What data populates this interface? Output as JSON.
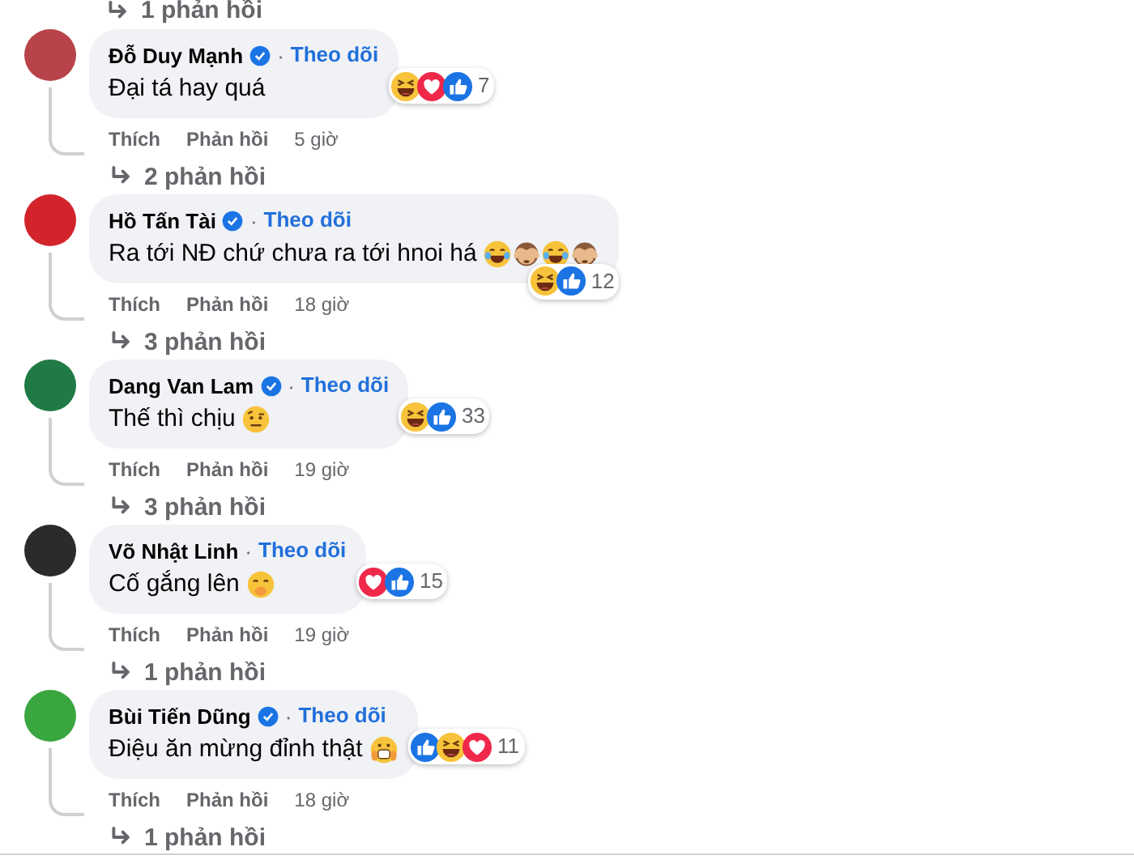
{
  "top_replies": "1 phản hồi",
  "comments": [
    {
      "author": "Đỗ Duy Mạnh",
      "verified": true,
      "separator": "·",
      "follow": "Theo dõi",
      "color": "#b8434a",
      "text": "Đại tá hay quá",
      "reactions": [
        {
          "kind": "haha"
        },
        {
          "kind": "love"
        },
        {
          "kind": "like"
        }
      ],
      "reaction_count": "7",
      "actions": [
        "Thích",
        "Phản hồi"
      ],
      "time": "5 giờ",
      "replies": "2 phản hồi"
    },
    {
      "author": "Hồ Tấn Tài",
      "verified": true,
      "separator": "·",
      "follow": "Theo dõi",
      "color": "#d3242c",
      "text": "Ra tới NĐ chứ chưa ra tới hnoi há",
      "emoji": [
        {
          "kind": "tears-of-joy"
        },
        {
          "kind": "monkey"
        },
        {
          "kind": "tears-of-joy"
        },
        {
          "kind": "monkey"
        }
      ],
      "reactions": [
        {
          "kind": "haha"
        },
        {
          "kind": "like"
        }
      ],
      "reaction_count": "12",
      "actions": [
        "Thích",
        "Phản hồi"
      ],
      "time": "18 giờ",
      "replies": "3 phản hồi"
    },
    {
      "author": "Dang Van Lam",
      "verified": true,
      "separator": "·",
      "follow": "Theo dõi",
      "color": "#1f7a45",
      "text": "Thế thì chịu",
      "emoji": [
        {
          "kind": "eyebrow-face"
        }
      ],
      "reactions": [
        {
          "kind": "haha"
        },
        {
          "kind": "like"
        }
      ],
      "reaction_count": "33",
      "actions": [
        "Thích",
        "Phản hồi"
      ],
      "time": "19 giờ",
      "replies": "3 phản hồi"
    },
    {
      "author": "Võ Nhật Linh",
      "verified": false,
      "separator": "·",
      "follow": "Theo dõi",
      "color": "#2b2b2b",
      "text": "Cố gắng lên",
      "emoji": [
        {
          "kind": "hand-face"
        }
      ],
      "reactions": [
        {
          "kind": "love"
        },
        {
          "kind": "like"
        }
      ],
      "reaction_count": "15",
      "actions": [
        "Thích",
        "Phản hồi"
      ],
      "time": "19 giờ",
      "replies": "1 phản hồi"
    },
    {
      "author": "Bùi Tiến Dũng",
      "verified": true,
      "separator": "·",
      "follow": "Theo dõi",
      "color": "#3aa63f",
      "text": "Điệu ăn mừng đỉnh thật",
      "emoji": [
        {
          "kind": "teeth-face"
        }
      ],
      "reactions": [
        {
          "kind": "like"
        },
        {
          "kind": "haha"
        },
        {
          "kind": "love"
        }
      ],
      "reaction_count": "11",
      "actions": [
        "Thích",
        "Phản hồi"
      ],
      "time": "18 giờ",
      "replies": "1 phản hồi"
    }
  ]
}
